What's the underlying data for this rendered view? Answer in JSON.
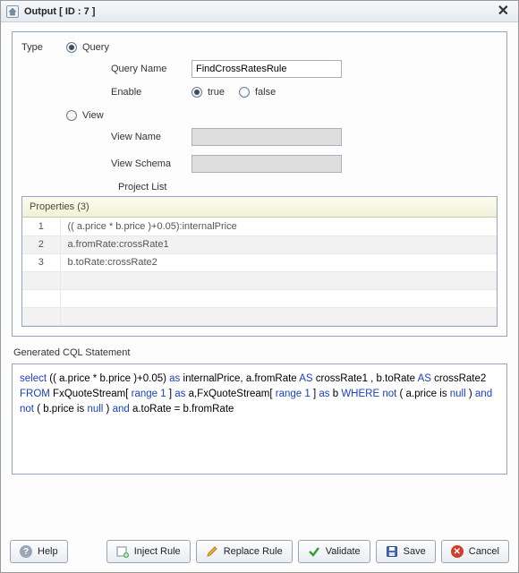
{
  "title": "Output [ ID : 7 ]",
  "type_label": "Type",
  "radios": {
    "query": "Query",
    "view": "View",
    "selected": "query"
  },
  "query": {
    "name_label": "Query Name",
    "name_value": "FindCrossRatesRule",
    "enable_label": "Enable",
    "enable_true": "true",
    "enable_false": "false",
    "enable_selected": "true"
  },
  "view": {
    "name_label": "View Name",
    "name_value": "",
    "schema_label": "View Schema",
    "schema_value": ""
  },
  "project_list": {
    "label": "Project List",
    "header": "Properties (3)",
    "rows": [
      {
        "n": "1",
        "text": "(( a.price * b.price )+0.05):internalPrice"
      },
      {
        "n": "2",
        "text": "a.fromRate:crossRate1"
      },
      {
        "n": "3",
        "text": "b.toRate:crossRate2"
      }
    ]
  },
  "cql": {
    "label": "Generated CQL Statement",
    "tokens": [
      {
        "t": "select",
        "c": "kw-blue"
      },
      {
        "t": " (( a.price * b.price )+0.05) ",
        "c": "kw-black"
      },
      {
        "t": "as",
        "c": "kw-blue"
      },
      {
        "t": " internalPrice, a.fromRate ",
        "c": "kw-black"
      },
      {
        "t": "AS",
        "c": "kw-blue"
      },
      {
        "t": " crossRate1 , b.toRate ",
        "c": "kw-black"
      },
      {
        "t": "AS",
        "c": "kw-blue"
      },
      {
        "t": " crossRate2 ",
        "c": "kw-black"
      },
      {
        "t": "FROM",
        "c": "kw-blue"
      },
      {
        "t": " FxQuoteStream[ ",
        "c": "kw-black"
      },
      {
        "t": "range 1",
        "c": "kw-blue"
      },
      {
        "t": " ] ",
        "c": "kw-black"
      },
      {
        "t": "as",
        "c": "kw-blue"
      },
      {
        "t": " a,FxQuoteStream[ ",
        "c": "kw-black"
      },
      {
        "t": "range 1",
        "c": "kw-blue"
      },
      {
        "t": " ] ",
        "c": "kw-black"
      },
      {
        "t": "as",
        "c": "kw-blue"
      },
      {
        "t": " b ",
        "c": "kw-black"
      },
      {
        "t": "WHERE",
        "c": "kw-blue"
      },
      {
        "t": "  ",
        "c": "kw-black"
      },
      {
        "t": "not",
        "c": "kw-blue"
      },
      {
        "t": " ( a.price is ",
        "c": "kw-black"
      },
      {
        "t": "null",
        "c": "kw-blue"
      },
      {
        "t": " )  ",
        "c": "kw-black"
      },
      {
        "t": "and not",
        "c": "kw-blue"
      },
      {
        "t": " (  b.price is ",
        "c": "kw-black"
      },
      {
        "t": "null",
        "c": "kw-blue"
      },
      {
        "t": " )  ",
        "c": "kw-black"
      },
      {
        "t": "and",
        "c": "kw-blue"
      },
      {
        "t": "  a.toRate  =  b.fromRate",
        "c": "kw-black"
      }
    ]
  },
  "buttons": {
    "help": "Help",
    "inject": "Inject Rule",
    "replace": "Replace Rule",
    "validate": "Validate",
    "save": "Save",
    "cancel": "Cancel"
  }
}
